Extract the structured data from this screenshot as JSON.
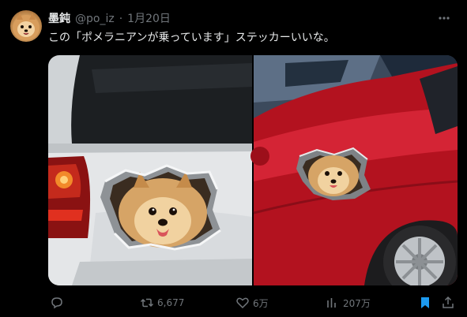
{
  "author": {
    "name": "墨鈍",
    "handle": "@po_iz",
    "separator": "·",
    "date": "1月20日"
  },
  "tweet": {
    "text": "この「ポメラニアンが乗っています」ステッカーいいな。"
  },
  "media": {
    "images": [
      {
        "description_icon": "white-car-pomeranian-sticker-photo"
      },
      {
        "description_icon": "red-car-pomeranian-sticker-photo"
      }
    ]
  },
  "actions": {
    "reply": {
      "icon": "reply-icon",
      "count": ""
    },
    "retweet": {
      "icon": "retweet-icon",
      "count": "6,677"
    },
    "like": {
      "icon": "heart-icon",
      "count": "6万"
    },
    "views": {
      "icon": "views-icon",
      "count": "207万"
    },
    "bookmark": {
      "icon": "bookmark-icon",
      "active": true
    },
    "share": {
      "icon": "share-icon"
    }
  },
  "colors": {
    "background": "#000000",
    "text": "#e7e9ea",
    "muted": "#71767b",
    "bookmark_active": "#1d9bf0"
  }
}
